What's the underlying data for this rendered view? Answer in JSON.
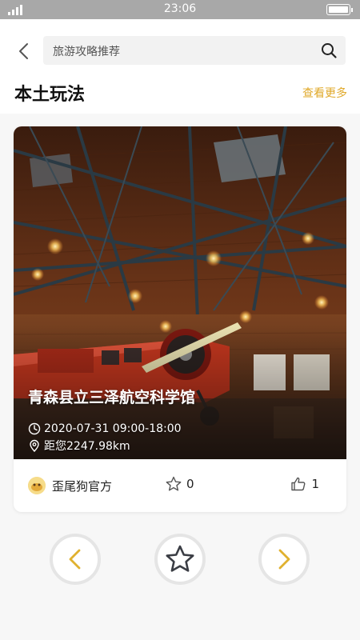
{
  "status_bar": {
    "time": "23:06",
    "signal_icon": "signal-icon",
    "battery_icon": "battery-icon"
  },
  "search": {
    "placeholder": "旅游攻略推荐"
  },
  "section": {
    "title": "本土玩法",
    "more_label": "查看更多"
  },
  "card": {
    "place_name": "青森县立三泽航空科学馆",
    "datetime": "2020-07-31 09:00-18:00",
    "distance": "距您2247.98km",
    "author": "歪尾狗官方",
    "favorite_count": "0",
    "like_count": "1"
  },
  "colors": {
    "accent": "#e0a92a",
    "status_bar": "#a8a8a8",
    "background": "#f7f7f7"
  },
  "controls": {
    "prev_icon": "chevron-left-icon",
    "favorite_icon": "star-icon",
    "next_icon": "chevron-right-icon"
  }
}
